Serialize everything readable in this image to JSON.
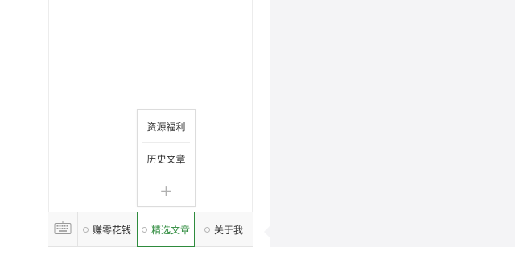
{
  "menu": {
    "keyboard_icon": "keyboard-icon",
    "items": [
      {
        "label": "赚零花钱"
      },
      {
        "label": "精选文章"
      },
      {
        "label": "关于我"
      }
    ],
    "selected_index": 1,
    "accent_color": "#2e8b3d"
  },
  "submenu": {
    "items": [
      {
        "label": "资源福利"
      },
      {
        "label": "历史文章"
      }
    ],
    "add_icon": "plus-icon",
    "add_symbol": "+"
  }
}
